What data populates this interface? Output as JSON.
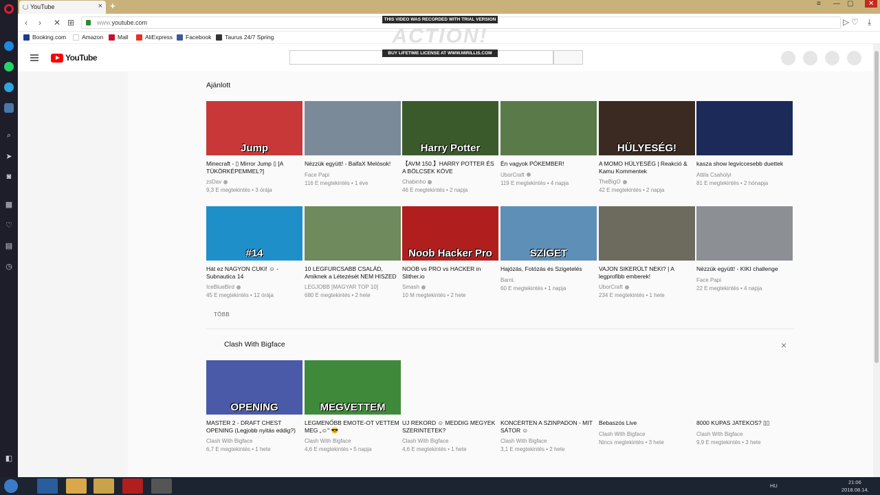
{
  "browser": {
    "tab_title": "YouTube",
    "tab_close": "×",
    "new_tab": "+",
    "url_prefix": "www.",
    "url_host": "youtube.com",
    "bookmarks": [
      {
        "label": "Booking.com",
        "color": "#1a3d8f"
      },
      {
        "label": "Amazon",
        "color": "#ffffff"
      },
      {
        "label": "Mall",
        "color": "#c8102e"
      },
      {
        "label": "AliExpress",
        "color": "#e43225"
      },
      {
        "label": "Facebook",
        "color": "#3b5998"
      },
      {
        "label": "Taurus 24/7 Spring",
        "color": "#333333"
      }
    ],
    "sidebar_icons": [
      "messenger-icon",
      "whatsapp-icon",
      "telegram-icon",
      "vk-icon",
      "search-icon",
      "send-icon",
      "camera-icon",
      "speed-dial-icon",
      "heart-icon",
      "news-icon",
      "history-icon"
    ]
  },
  "watermark": {
    "top": "THIS VIDEO WAS RECORDED WITH TRIAL VERSION",
    "logo": "ACTION!",
    "bottom": "BUY LIFETIME LICENSE AT WWW.MIRILLIS.COM"
  },
  "youtube": {
    "logo_text": "YouTube",
    "recommended_title": "Ajánlott",
    "more_label": "TÖBB",
    "channel_section_title": "Clash With Bigface",
    "close_label": "×",
    "recommended": [
      {
        "title": "Minecraft - ▯ Mirror Jump ▯ [A TÜKÖRKÉPEMMEL?]",
        "channel": "zsDav",
        "meta": "9,3 E megtekintés • 3 órája",
        "thumb_color": "#c93838",
        "thumb_text": "Jump",
        "verified": true
      },
      {
        "title": "Nézzük együtt! - BalfaX Melósok!",
        "channel": "Face Papi",
        "meta": "116 E megtekintés • 1 éve",
        "thumb_color": "#7b8a99",
        "thumb_text": "",
        "verified": false
      },
      {
        "title": "【AVM 150.】HARRY POTTER ÉS A BÖLCSEK KÖVE",
        "channel": "Chabinho",
        "meta": "46 E megtekintés • 2 napja",
        "thumb_color": "#3b5a2c",
        "thumb_text": "Harry Potter",
        "verified": true
      },
      {
        "title": "Én vagyok PÓKEMBER!",
        "channel": "UborCraft",
        "meta": "119 E megtekintés • 4 napja",
        "thumb_color": "#5a7a4a",
        "thumb_text": "",
        "verified": true
      },
      {
        "title": "A MOMO HÜLYESÉG | Reakció & Kamu Kommentek",
        "channel": "TheBigO",
        "meta": "42 E megtekintés • 2 napja",
        "thumb_color": "#3a2a22",
        "thumb_text": "HÜLYESÉG!",
        "verified": true
      },
      {
        "title": "kasza show legviccesebb duettek",
        "channel": "Attila Csaholyi",
        "meta": "81 E megtekintés • 2 hónapja",
        "thumb_color": "#1c2a5a",
        "thumb_text": "",
        "verified": false
      },
      {
        "title": "Hát ez NAGYON CUKI! ☺ - Subnautica 14",
        "channel": "IceBlueBird",
        "meta": "45 E megtekintés • 12 órája",
        "thumb_color": "#1f8fc9",
        "thumb_text": "#14",
        "verified": true
      },
      {
        "title": "10 LEGFURCSABB CSALÁD, Amiknek a Létezését NEM HISZED EL!",
        "channel": "LEGJOBB [MAGYAR TOP 10]",
        "meta": "680 E megtekintés • 2 hete",
        "thumb_color": "#6f8a5c",
        "thumb_text": "",
        "verified": false
      },
      {
        "title": "NOOB vs PRO vs HACKER in Slither.io",
        "channel": "Smash",
        "meta": "10 M megtekintés • 2 hete",
        "thumb_color": "#b01e1e",
        "thumb_text": "Noob Hacker Pro",
        "verified": true
      },
      {
        "title": "Hajózás, Fotózás és Szigetelés",
        "channel": "Barni.",
        "meta": "60 E megtekintés • 1 napja",
        "thumb_color": "#5d8fb7",
        "thumb_text": "SZIGET",
        "verified": false
      },
      {
        "title": "VAJON SIKERÜLT NEKI? | A legprofibb emberek!",
        "channel": "UborCraft",
        "meta": "234 E megtekintés • 1 hete",
        "thumb_color": "#6d6a5e",
        "thumb_text": "",
        "verified": true
      },
      {
        "title": "Nézzük együtt! - KIKI challenge",
        "channel": "Face Papi",
        "meta": "22 E megtekintés • 4 napja",
        "thumb_color": "#8c8f94",
        "thumb_text": "",
        "verified": false
      }
    ],
    "channel_videos": [
      {
        "title": "MASTER 2 - DRAFT CHEST OPENING (Legjobb nyitás eddig?)",
        "channel": "Clash With Bigface",
        "meta": "6,7 E megtekintés • 1 hete",
        "thumb_color": "#4a5aa8",
        "thumb_text": "OPENING"
      },
      {
        "title": "LEGMENŐBB EMOTE-OT VETTEM MEG „☺\" 😎",
        "channel": "Clash With Bigface",
        "meta": "4,6 E megtekintés • 5 napja",
        "thumb_color": "#3f8a3a",
        "thumb_text": "MEGVETTEM"
      },
      {
        "title": "UJ REKORD ☺ MEDDIG MEGYEK SZERINTETEK?",
        "channel": "Clash With Bigface",
        "meta": "4,6 E megtekintés • 1 hete",
        "thumb_color": "",
        "thumb_text": ""
      },
      {
        "title": "KONCERTEN A SZINPADON - MIT SÁTOR ☺",
        "channel": "Clash With Bigface",
        "meta": "3,1 E megtekintés • 2 hete",
        "thumb_color": "",
        "thumb_text": ""
      },
      {
        "title": "Bebaszós Live",
        "channel": "Clash With Bigface",
        "meta": "Nincs megtekintés • 3 hete",
        "thumb_color": "",
        "thumb_text": ""
      },
      {
        "title": "8000 KUPAS JATEKOS? ▯▯",
        "channel": "Clash With Bigface",
        "meta": "9,9 E megtekintés • 3 hete",
        "thumb_color": "",
        "thumb_text": ""
      }
    ]
  },
  "taskbar": {
    "lang": "HU",
    "time": "21:06",
    "date": "2018.08.14."
  }
}
